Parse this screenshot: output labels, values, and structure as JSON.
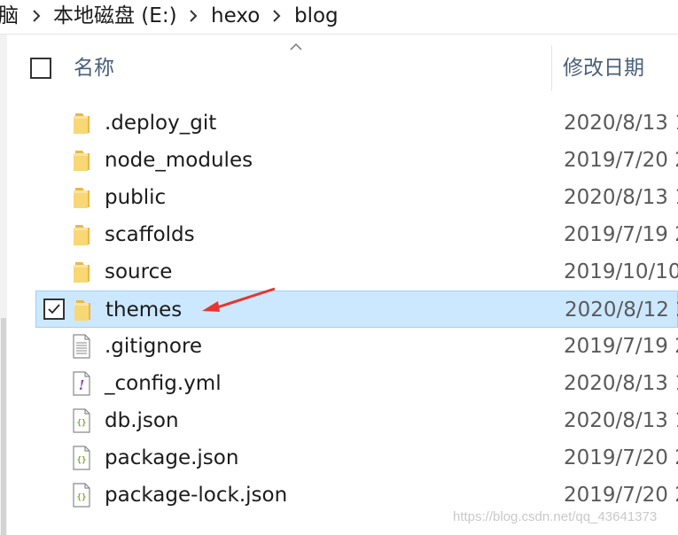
{
  "breadcrumb": {
    "items": [
      "脑",
      "本地磁盘 (E:)",
      "hexo",
      "blog"
    ]
  },
  "header": {
    "name_label": "名称",
    "date_label": "修改日期"
  },
  "files": [
    {
      "name": ".deploy_git",
      "date": "2020/8/13 1",
      "type": "folder",
      "selected": false
    },
    {
      "name": "node_modules",
      "date": "2019/7/20 2",
      "type": "folder",
      "selected": false
    },
    {
      "name": "public",
      "date": "2020/8/13 1",
      "type": "folder",
      "selected": false
    },
    {
      "name": "scaffolds",
      "date": "2019/7/19 2",
      "type": "folder",
      "selected": false
    },
    {
      "name": "source",
      "date": "2019/10/10",
      "type": "folder",
      "selected": false
    },
    {
      "name": "themes",
      "date": "2020/8/12 2",
      "type": "folder",
      "selected": true
    },
    {
      "name": ".gitignore",
      "date": "2019/7/19 2",
      "type": "text-file",
      "selected": false
    },
    {
      "name": "_config.yml",
      "date": "2020/8/13 1",
      "type": "yml-file",
      "selected": false
    },
    {
      "name": "db.json",
      "date": "2020/8/13 1",
      "type": "json-file",
      "selected": false
    },
    {
      "name": "package.json",
      "date": "2019/7/20 2",
      "type": "json-file",
      "selected": false
    },
    {
      "name": "package-lock.json",
      "date": "2019/7/20 2",
      "type": "json-file",
      "selected": false
    }
  ],
  "watermark": "https://blog.csdn.net/qq_43641373",
  "colors": {
    "selection_bg": "#cce8ff",
    "selection_border": "#99d1ff",
    "folder": "#f8d775",
    "annotation_arrow": "#e8352e"
  }
}
